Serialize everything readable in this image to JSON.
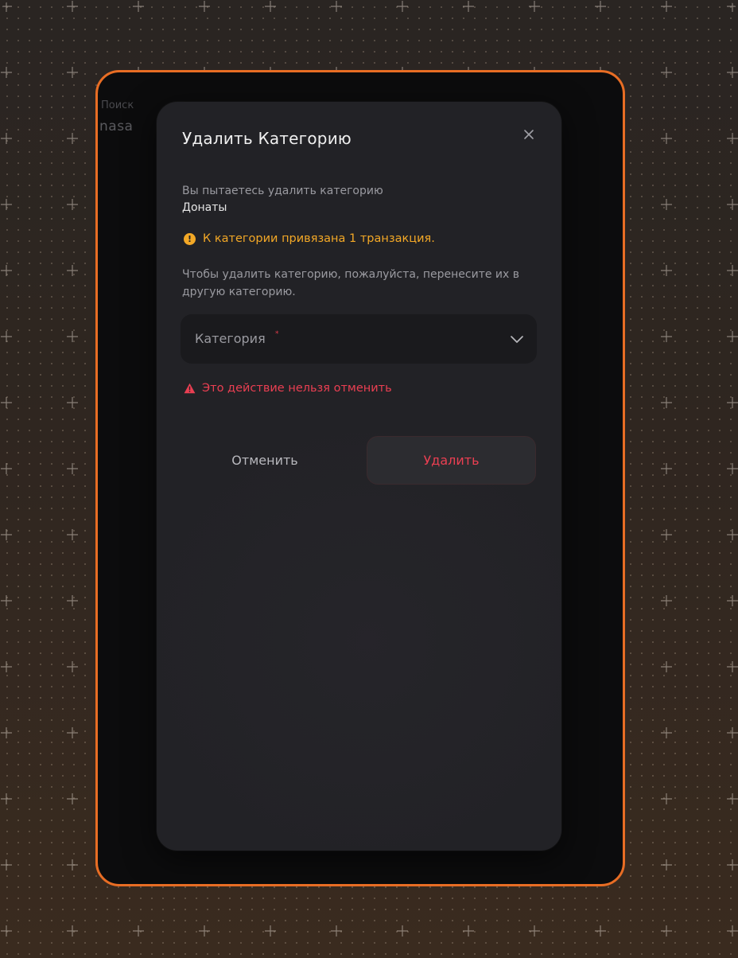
{
  "background": {
    "search_label": "Поиск",
    "search_value": "nasa"
  },
  "modal": {
    "title": "Удалить Категорию",
    "description": "Вы пытаетесь удалить категорию",
    "category_name": "Донаты",
    "warning_text": "К категории привязана 1 транзакция.",
    "instruction": "Чтобы удалить категорию, пожалуйста, перенесите их в другую категорию.",
    "select": {
      "placeholder": "Категория",
      "required_mark": "*",
      "selected_value": ""
    },
    "danger_text": "Это действие нельзя отменить",
    "cancel_label": "Отменить",
    "delete_label": "Удалить"
  },
  "colors": {
    "accent_border": "#e86d24",
    "warning": "#f3a826",
    "danger": "#ea3f52",
    "modal_bg": "#222226"
  },
  "icons": {
    "close": "close-icon",
    "warning": "exclamation-circle-icon",
    "danger": "alert-triangle-icon",
    "dropdown": "chevron-down-icon"
  }
}
